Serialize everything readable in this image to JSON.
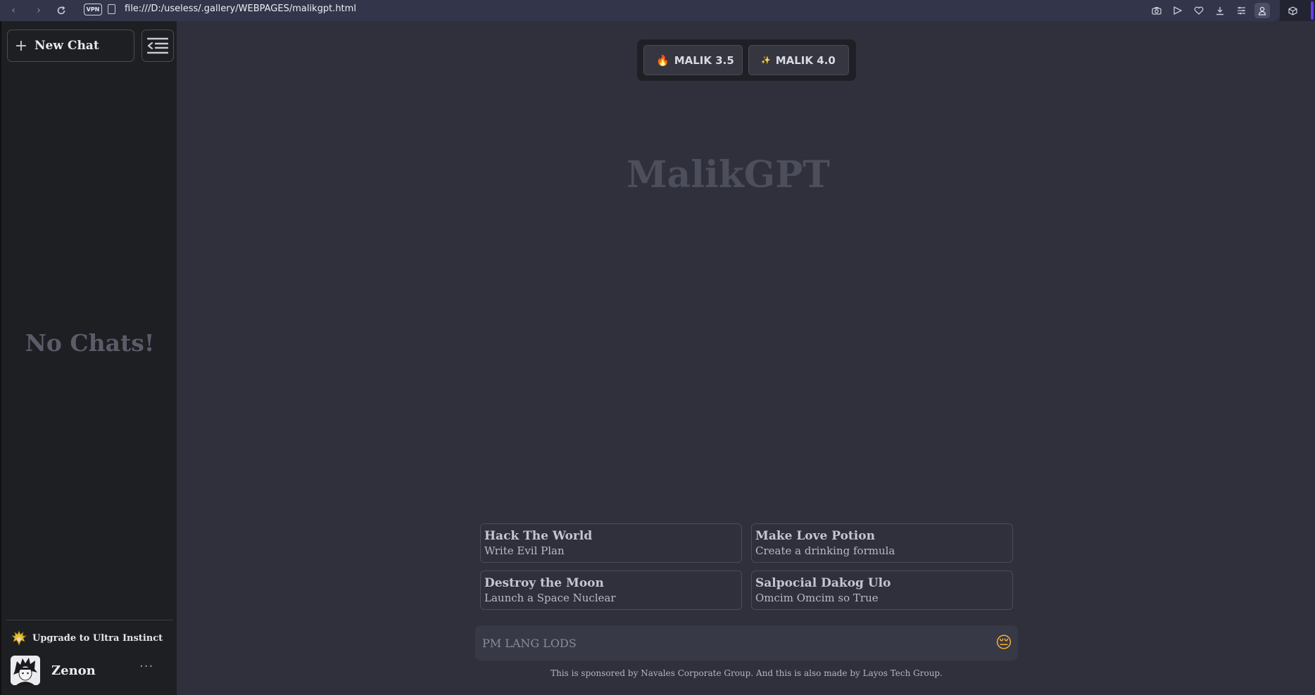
{
  "browser": {
    "vpn_label": "VPN",
    "url": "file:///D:/useless/.gallery/WEBPAGES/malikgpt.html"
  },
  "sidebar": {
    "new_chat_label": "New Chat",
    "empty_text": "No Chats!",
    "upgrade_label": "Upgrade to Ultra Instinct",
    "user_name": "Zenon",
    "more_label": "···"
  },
  "models": [
    {
      "icon": "🔥",
      "label": "MALIK 3.5"
    },
    {
      "icon": "✨",
      "label": "MALIK 4.0"
    }
  ],
  "brand_title": "MalikGPT",
  "suggestions": [
    {
      "title": "Hack The World",
      "subtitle": "Write Evil Plan"
    },
    {
      "title": "Make Love Potion",
      "subtitle": "Create a drinking formula"
    },
    {
      "title": "Destroy the Moon",
      "subtitle": "Launch a Space Nuclear"
    },
    {
      "title": "Salpocial Dakog Ulo",
      "subtitle": "Omcim Omcim so True"
    }
  ],
  "prompt": {
    "placeholder": "PM LANG LODS",
    "emoji": "😔"
  },
  "footer_text": "This is sponsored by Navales Corporate Group. And this is also made by Layos Tech Group.",
  "colors": {
    "accent": "#6c3cf0",
    "sidebar_bg": "#1e1f23",
    "main_bg": "#2f303b"
  }
}
